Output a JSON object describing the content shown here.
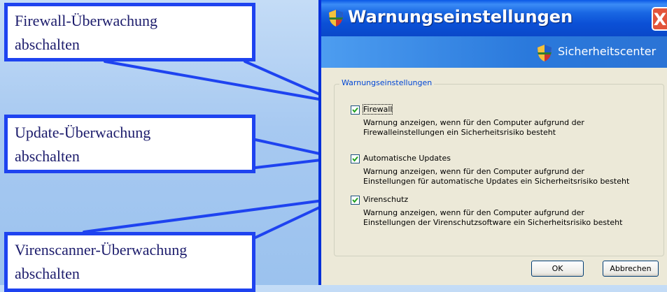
{
  "callouts": {
    "firewall": [
      "Firewall-Überwachung",
      "abschalten"
    ],
    "update": [
      "Update-Überwachung",
      "abschalten"
    ],
    "virus": [
      "Virenscanner-Überwachung",
      "abschalten"
    ]
  },
  "dialog": {
    "title": "Warnungseinstellungen",
    "close_label": "X",
    "banner_text": "Sicherheitscenter",
    "group_title": "Warnungseinstellungen",
    "options": [
      {
        "label": "Firewall",
        "checked": true,
        "desc": [
          "Warnung anzeigen, wenn für den Computer aufgrund der",
          "Firewalleinstellungen ein Sicherheitsrisiko besteht"
        ]
      },
      {
        "label": "Automatische Updates",
        "checked": true,
        "desc": [
          "Warnung anzeigen, wenn für den Computer aufgrund der",
          "Einstellungen für automatische Updates ein Sicherheitsrisiko besteht"
        ]
      },
      {
        "label": "Virenschutz",
        "checked": true,
        "desc": [
          "Warnung anzeigen, wenn für den Computer aufgrund der",
          "Einstellungen der Virenschutzsoftware ein Sicherheitsrisiko besteht"
        ]
      }
    ],
    "ok_label": "OK",
    "cancel_label": "Abbrechen"
  },
  "colors": {
    "callout_border": "#1e43f0",
    "titlebar": "#0b50d6",
    "dialog_bg": "#ece9d8"
  },
  "icons": [
    "shield-icon",
    "checkmark-icon",
    "close-icon"
  ]
}
